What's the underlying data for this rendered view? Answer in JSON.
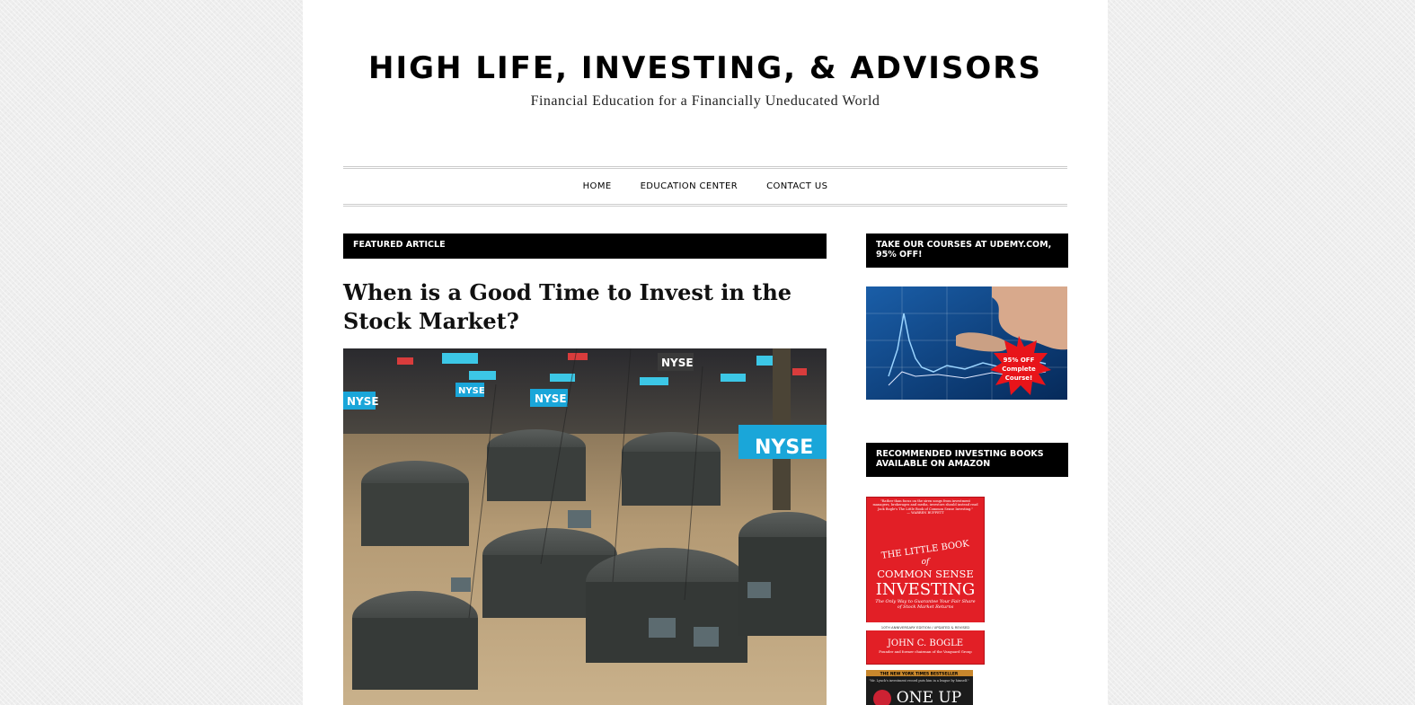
{
  "site": {
    "title": "HIGH LIFE, INVESTING, & ADVISORS",
    "description": "Financial Education for a Financially Uneducated World"
  },
  "nav": {
    "items": [
      {
        "label": "HOME"
      },
      {
        "label": "EDUCATION CENTER"
      },
      {
        "label": "CONTACT US"
      }
    ]
  },
  "main": {
    "featured_label": "FEATURED ARTICLE",
    "article_title": "When is a Good Time to Invest in the Stock Market?",
    "image_signs": [
      "NYSE",
      "NYSE",
      "NYSE",
      "NYSE",
      "NYSE"
    ]
  },
  "sidebar": {
    "udemy_title": "TAKE OUR COURSES AT UDEMY.COM, 95% OFF!",
    "udemy_badge": [
      "95% OFF",
      "Complete",
      "Course!"
    ],
    "books_title": "RECOMMENDED INVESTING BOOKS AVAILABLE ON AMAZON",
    "book1": {
      "quote": "\"Rather than focus on the siren songs from investment managers, brokerages and media, investors should instead read Jack Bogle's The Little Book of Common Sense Investing.\"",
      "quote_author": "— WARREN BUFFETT",
      "title_line1": "THE LITTLE BOOK",
      "title_line2": "of",
      "title_line3": "COMMON SENSE",
      "title_line4": "INVESTING",
      "subtitle": "The Only Way to Guarantee Your Fair Share of Stock Market Returns",
      "edition": "10TH ANNIVERSARY EDITION / UPDATED & REVISED",
      "author": "JOHN C. BOGLE",
      "author_note": "Founder and former chairman of the Vanguard Group"
    },
    "book2": {
      "banner": "THE NEW YORK TIMES BESTSELLER",
      "quote": "\"Mr. Lynch's investment record puts him in a league by himself.\"",
      "title": "ONE UP"
    }
  },
  "colors": {
    "bar_bg": "#000000",
    "bar_text": "#ffffff",
    "page_bg": "#eeeeee",
    "book1_red": "#e21f26",
    "ad_blue": "#0d3a73",
    "badge_red": "#e8141a"
  }
}
